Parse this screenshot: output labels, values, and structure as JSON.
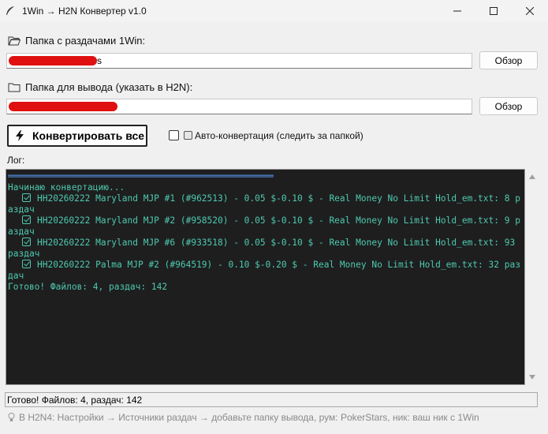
{
  "window": {
    "title": "1Win → H2N Конвертер v1.0",
    "minimize_glyph": "—",
    "maximize_glyph": "☐",
    "close_glyph": "✕"
  },
  "source": {
    "label": "Папка с раздачами 1Win:",
    "value": "s",
    "browse_label": "Обзор",
    "icon": "folder-open-icon"
  },
  "output": {
    "label": "Папка для вывода (указать в H2N):",
    "value": "",
    "browse_label": "Обзор",
    "icon": "folder-icon"
  },
  "actions": {
    "convert_label": "Конвертировать все",
    "convert_icon": "lightning-icon",
    "auto_label": "Авто-конвертация (следить за папкой)",
    "auto_checked": false
  },
  "log": {
    "label": "Лог:",
    "separator": "══════════════════════════════════════════════════",
    "start_line": "Начинаю конвертацию...",
    "entries": [
      "HH20260222 Maryland MJP #1 (#962513) - 0.05 $-0.10 $ - Real Money No Limit Hold_em.txt: 8 раздач",
      "HH20260222 Maryland MJP #2 (#958520) - 0.05 $-0.10 $ - Real Money No Limit Hold_em.txt: 9 раздач",
      "HH20260222 Maryland MJP #6 (#933518) - 0.05 $-0.10 $ - Real Money No Limit Hold_em.txt: 93 раздач",
      "HH20260222 Palma MJP #2 (#964519) - 0.10 $-0.20 $ - Real Money No Limit Hold_em.txt: 32 раздач"
    ],
    "done_line": "Готово! Файлов: 4, раздач: 142",
    "text_color": "#4ec9b0",
    "background": "#1e1e1e"
  },
  "status": {
    "text": "Готово! Файлов: 4, раздач: 142"
  },
  "hint": {
    "text": "В H2N4: Настройки → Источники раздач → добавьте папку вывода, рум: PokerStars, ник: ваш ник с 1Win",
    "icon": "lightbulb-icon"
  }
}
